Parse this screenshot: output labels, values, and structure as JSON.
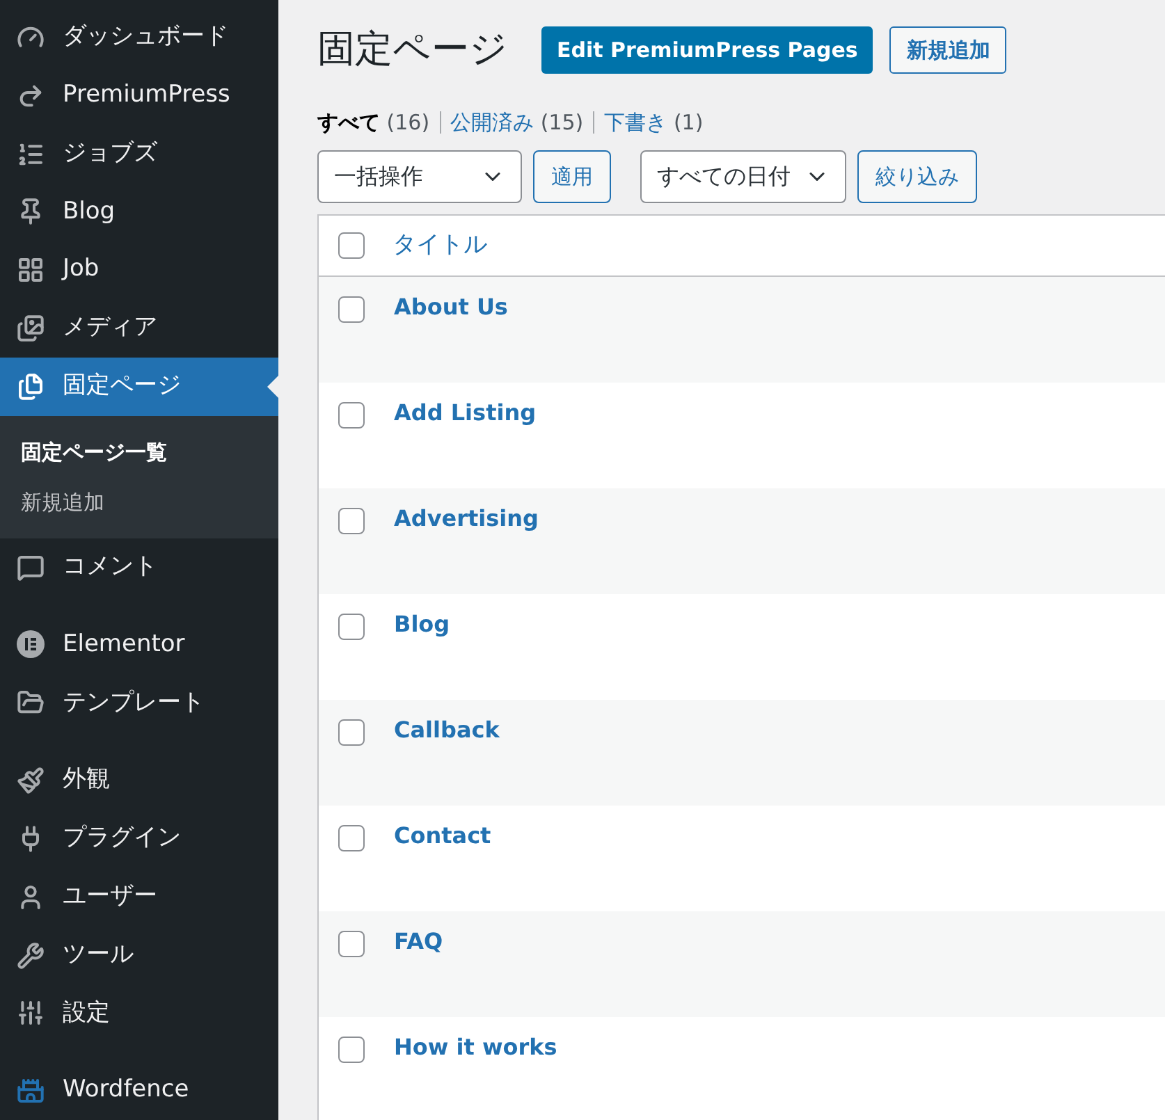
{
  "sidebar": {
    "items": [
      {
        "kind": "item",
        "label": "ダッシュボード",
        "selected": false
      },
      {
        "kind": "item",
        "label": "PremiumPress",
        "selected": false
      },
      {
        "kind": "item",
        "label": "ジョブズ",
        "selected": false
      },
      {
        "kind": "item",
        "label": "Blog",
        "selected": false
      },
      {
        "kind": "item",
        "label": "Job",
        "selected": false
      },
      {
        "kind": "item",
        "label": "メディア",
        "selected": false
      },
      {
        "kind": "item",
        "label": "固定ページ",
        "selected": true,
        "children": [
          {
            "label": "固定ページ一覧",
            "selected": true
          },
          {
            "label": "新規追加",
            "selected": false
          }
        ]
      },
      {
        "kind": "item",
        "label": "コメント",
        "selected": false
      },
      {
        "kind": "separator"
      },
      {
        "kind": "item",
        "label": "Elementor",
        "selected": false
      },
      {
        "kind": "item",
        "label": "テンプレート",
        "selected": false
      },
      {
        "kind": "separator"
      },
      {
        "kind": "item",
        "label": "外観",
        "selected": false
      },
      {
        "kind": "item",
        "label": "プラグイン",
        "selected": false
      },
      {
        "kind": "item",
        "label": "ユーザー",
        "selected": false
      },
      {
        "kind": "item",
        "label": "ツール",
        "selected": false
      },
      {
        "kind": "item",
        "label": "設定",
        "selected": false
      },
      {
        "kind": "separator"
      },
      {
        "kind": "item",
        "label": "Wordfence",
        "selected": false
      }
    ]
  },
  "page": {
    "title": "固定ページ",
    "buttons": [
      {
        "kind": "primary",
        "label": "Edit PremiumPress Pages"
      },
      {
        "kind": "secondary",
        "label": "新規追加"
      }
    ]
  },
  "filters": [
    {
      "label": "すべて",
      "count": "(16)",
      "selected": true
    },
    {
      "label": "公開済み",
      "count": "(15)",
      "selected": false
    },
    {
      "label": "下書き",
      "count": "(1)",
      "selected": false
    }
  ],
  "toolbar": {
    "bulk_action": "一括操作",
    "apply": "適用",
    "date_filter": "すべての日付",
    "filter_button": "絞り込み"
  },
  "table": {
    "columns": [
      "タイトル"
    ],
    "header_checked": false,
    "rows": [
      {
        "title": "About Us",
        "checked": false
      },
      {
        "title": "Add Listing",
        "checked": false
      },
      {
        "title": "Advertising",
        "checked": false
      },
      {
        "title": "Blog",
        "checked": false
      },
      {
        "title": "Callback",
        "checked": false
      },
      {
        "title": "Contact",
        "checked": false
      },
      {
        "title": "FAQ",
        "checked": false
      },
      {
        "title": "How it works",
        "checked": false
      }
    ]
  }
}
